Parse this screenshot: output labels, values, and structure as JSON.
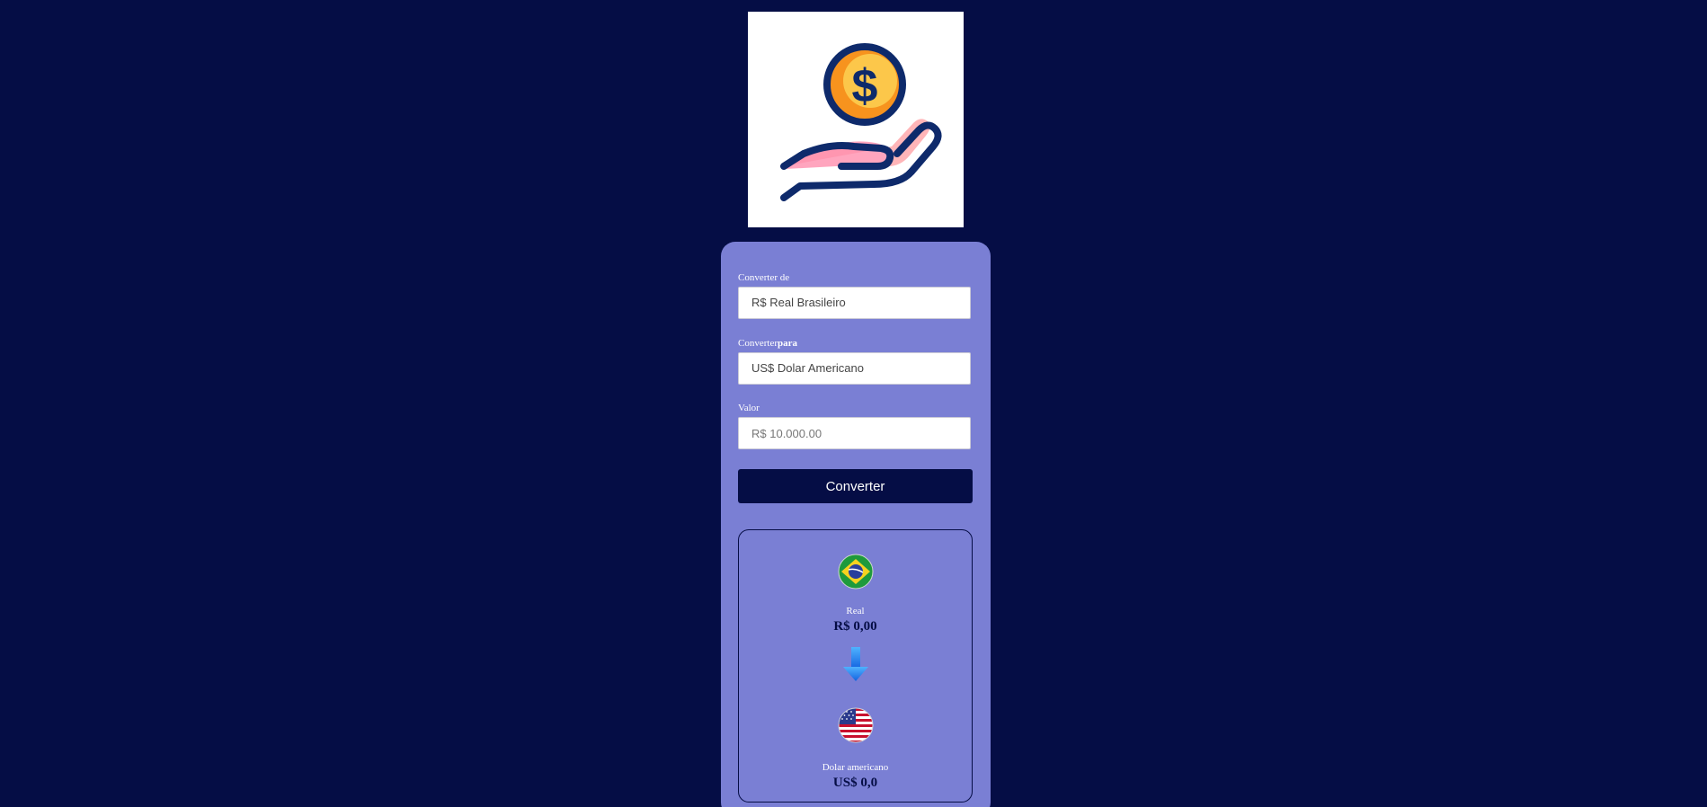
{
  "converter": {
    "from_label": "Converter de",
    "from_value": "R$ Real Brasileiro",
    "to_label_prefix": "Converter",
    "to_label_suffix": "para",
    "to_value": "US$ Dolar Americano",
    "amount_label": "Valor",
    "amount_placeholder": "R$ 10.000.00",
    "button_label": "Converter"
  },
  "result": {
    "source_flag_icon": "brazil-flag-icon",
    "source_name": "Real",
    "source_value": "R$ 0,00",
    "arrow_icon": "arrow-down-icon",
    "target_flag_icon": "usa-flag-icon",
    "target_name": "Dolar americano",
    "target_value": "US$ 0,0"
  },
  "logo_icon": "hand-holding-coin-icon",
  "colors": {
    "page_background": "#050d45",
    "panel_background": "#7a7fd4",
    "button_background": "#050d45",
    "coin": "#f5b731",
    "hand": "#ffb5b8",
    "outline": "#0e2a6b"
  }
}
